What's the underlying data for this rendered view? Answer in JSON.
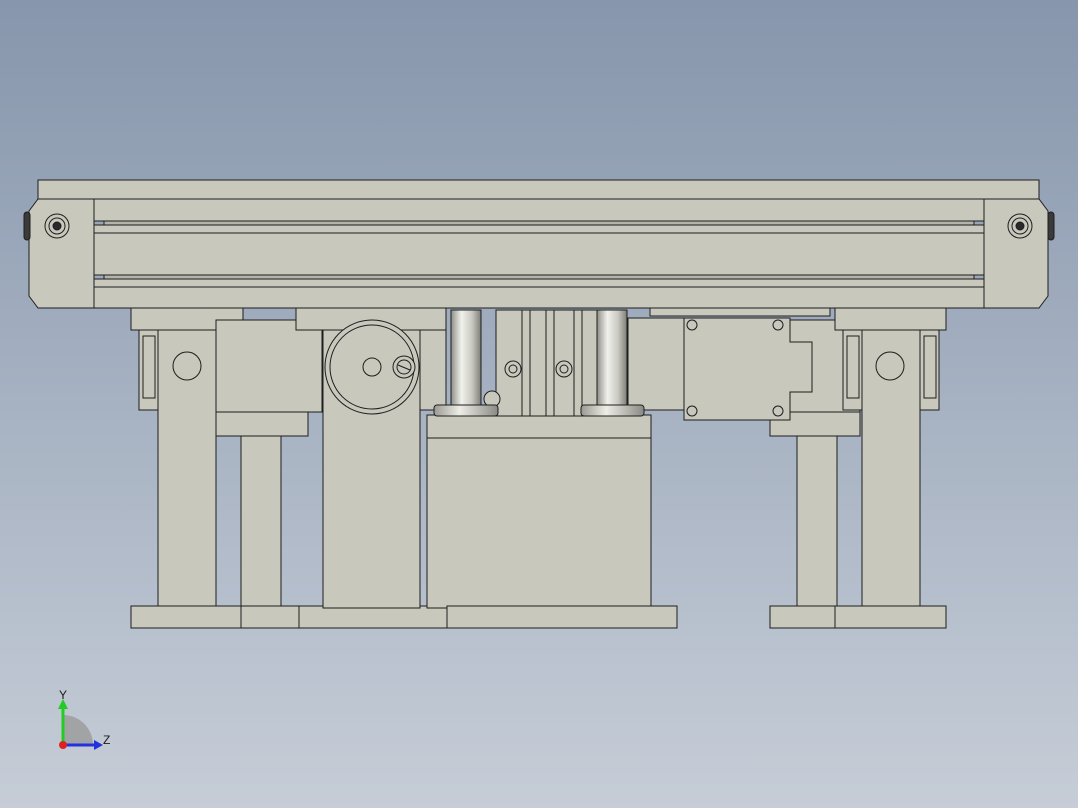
{
  "viewport": {
    "background_top": "#8796ac",
    "background_bottom": "#c6cdd7"
  },
  "model": {
    "part_fill": "#c8c8bd",
    "part_stroke": "#1e1e1e",
    "rod_fill": "#d9d9d2",
    "components": [
      "top-rail-beam",
      "left-end-cap",
      "right-end-cap",
      "left-support-leg",
      "right-support-leg",
      "drive-pulley-housing",
      "linear-guide-rods",
      "cylinder-block",
      "stepper-motor-mount"
    ]
  },
  "triad": {
    "y_label": "Y",
    "z_label": "Z",
    "y_color": "#22cc22",
    "z_color": "#2233dd",
    "x_color": "#dd2222"
  }
}
